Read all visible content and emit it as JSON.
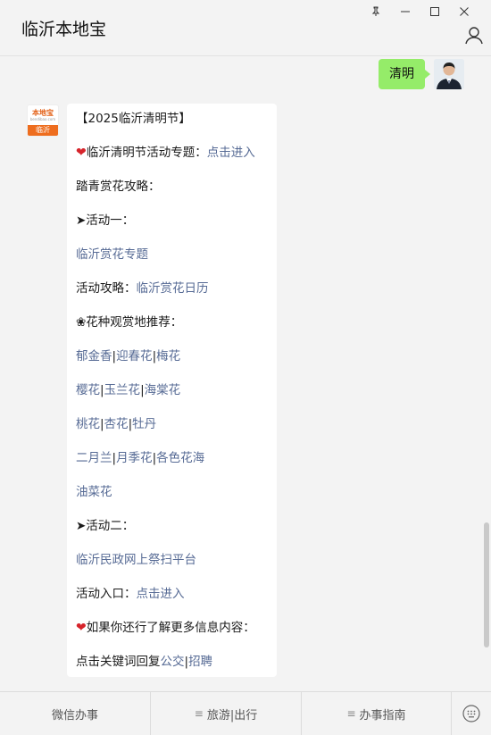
{
  "window": {
    "title": "临沂本地宝"
  },
  "sent_message": {
    "text": "清明"
  },
  "bot_avatar": {
    "brand": "本地宝",
    "sub": "bendibao.com",
    "city": "临沂"
  },
  "reply": {
    "line1": "【2025临沂清明节】",
    "line2_text": "临沂清明节活动专题：",
    "line2_link": "点击进入",
    "line3": "踏青赏花攻略：",
    "line4": "➤活动一：",
    "line5_link": "临沂赏花专题",
    "line6_text": "活动攻略：",
    "line6_link": "临沂赏花日历",
    "line7": "❀花种观赏地推荐：",
    "row1": [
      "郁金香",
      "迎春花",
      "梅花"
    ],
    "row2": [
      "樱花",
      "玉兰花",
      "海棠花"
    ],
    "row3": [
      "桃花",
      "杏花",
      "牡丹"
    ],
    "row4": [
      "二月兰",
      "月季花",
      "各色花海"
    ],
    "row5": [
      "油菜花"
    ],
    "line8": "➤活动二：",
    "line9_link": "临沂民政网上祭扫平台",
    "line10_text": "活动入口：",
    "line10_link": "点击进入",
    "line11_text": "如果你还行了解更多信息内容：",
    "line12_text": "点击关键词回复",
    "line12_link1": "公交",
    "line12_link2": "招聘",
    "separator": "|",
    "heart": "❤"
  },
  "tabbar": {
    "tab1": "微信办事",
    "tab2": "旅游|出行",
    "tab3": "办事指南",
    "menu_icon": "≡"
  },
  "colors": {
    "link": "#576b95",
    "sent_bubble": "#95ec69",
    "brand_orange": "#ee6d1e"
  }
}
